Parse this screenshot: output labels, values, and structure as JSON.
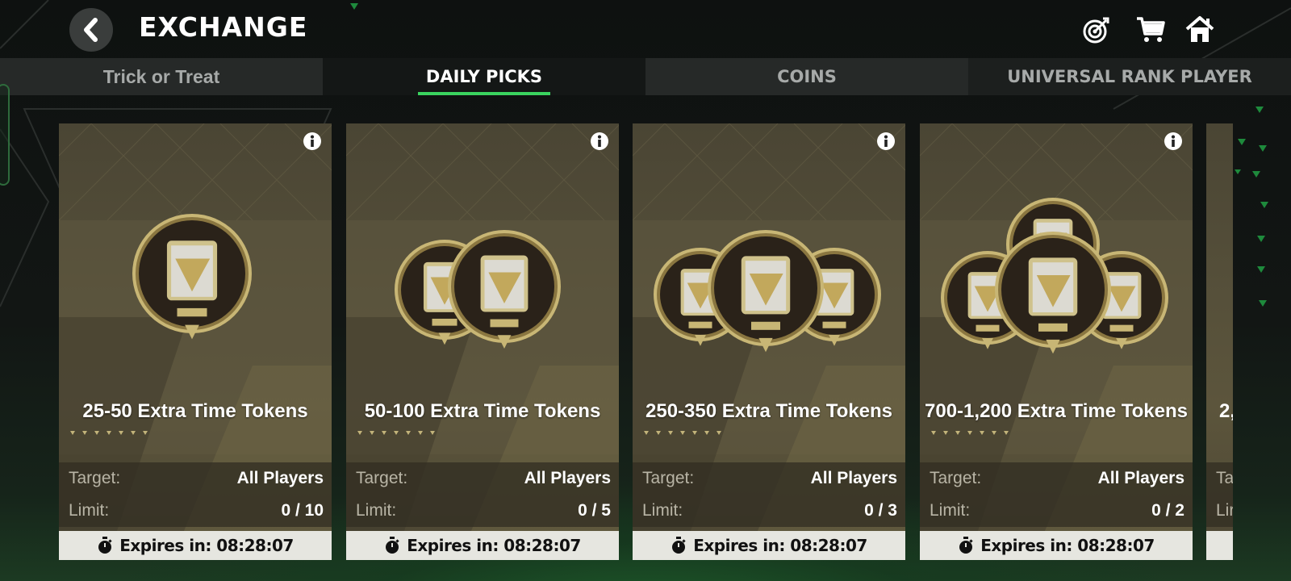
{
  "header": {
    "title": "EXCHANGE",
    "icons": [
      "back-chevron-icon",
      "target-icon",
      "cart-icon",
      "home-icon"
    ]
  },
  "tabs": [
    {
      "label": "Trick or Treat",
      "active": false
    },
    {
      "label": "DAILY PICKS",
      "active": true
    },
    {
      "label": "COINS",
      "active": false
    },
    {
      "label": "UNIVERSAL RANK PLAYER",
      "active": false
    }
  ],
  "cards": [
    {
      "title": "25-50 Extra Time Tokens",
      "target_label": "Target:",
      "target_value": "All Players",
      "limit_label": "Limit:",
      "limit_value": "0 / 10",
      "expires": "Expires in: 08:28:07",
      "token_count": 1
    },
    {
      "title": "50-100 Extra Time Tokens",
      "target_label": "Target:",
      "target_value": "All Players",
      "limit_label": "Limit:",
      "limit_value": "0 / 5",
      "expires": "Expires in: 08:28:07",
      "token_count": 2
    },
    {
      "title": "250-350 Extra Time Tokens",
      "target_label": "Target:",
      "target_value": "All Players",
      "limit_label": "Limit:",
      "limit_value": "0 / 3",
      "expires": "Expires in: 08:28:07",
      "token_count": 3
    },
    {
      "title": "700-1,200 Extra Time Tokens",
      "target_label": "Target:",
      "target_value": "All Players",
      "limit_label": "Limit:",
      "limit_value": "0 / 2",
      "expires": "Expires in: 08:28:07",
      "token_count": 4
    }
  ],
  "partial_card": {
    "title_fragment": "2,",
    "target_fragment": "Ta",
    "limit_fragment": "Lir"
  },
  "colors": {
    "tab_underline": "#3ad35f",
    "expires_bg": "#e6e6e0",
    "card_gold": "#c9b87a"
  }
}
